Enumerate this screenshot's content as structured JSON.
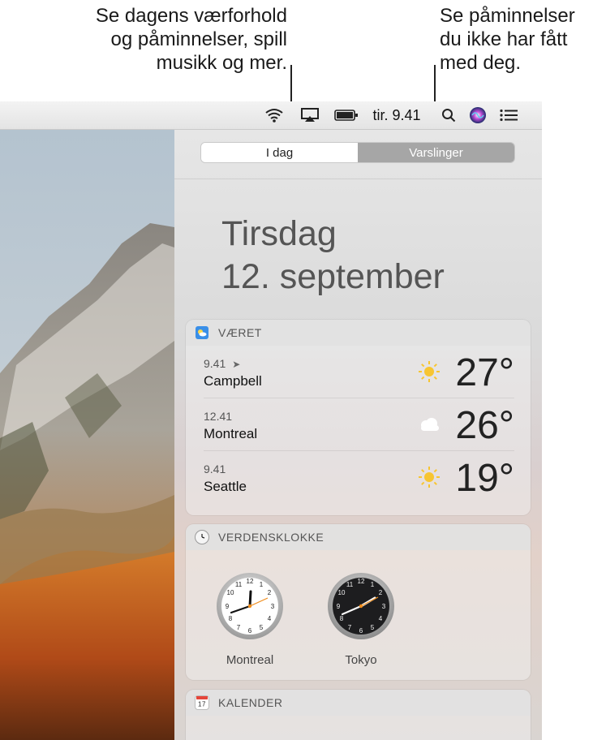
{
  "callouts": {
    "left": [
      "Se dagens værforhold",
      "og påminnelser, spill",
      "musikk og mer."
    ],
    "right": [
      "Se påminnelser",
      "du ikke har fått",
      "med deg."
    ]
  },
  "menubar": {
    "clock": "tir. 9.41",
    "icons": [
      "wifi-icon",
      "airplay-icon",
      "battery-icon",
      "search-icon",
      "siri-icon",
      "notification-center-icon"
    ]
  },
  "panel": {
    "tabs": [
      "I dag",
      "Varslinger"
    ],
    "selected_tab": "I dag",
    "weekday": "Tirsdag",
    "date": "12. september"
  },
  "weather": {
    "title": "VÆRET",
    "rows": [
      {
        "time": "9.41",
        "city": "Campbell",
        "temp": "27°",
        "condition": "sunny",
        "location_arrow": true
      },
      {
        "time": "12.41",
        "city": "Montreal",
        "temp": "26°",
        "condition": "cloudy",
        "location_arrow": false
      },
      {
        "time": "9.41",
        "city": "Seattle",
        "temp": "19°",
        "condition": "sunny",
        "location_arrow": false
      }
    ]
  },
  "world_clock": {
    "title": "VERDENSKLOKKE",
    "clocks": [
      {
        "city": "Montreal",
        "time": "12:41",
        "face": "light"
      },
      {
        "city": "Tokyo",
        "time": "01:41",
        "face": "dark"
      }
    ]
  },
  "calendar": {
    "title": "KALENDER"
  },
  "colors": {
    "sun": "#f7c531",
    "selected_tab": "#ffffff",
    "unselected_tab": "#a6a6a6",
    "second_hand": "#f08c1a"
  }
}
